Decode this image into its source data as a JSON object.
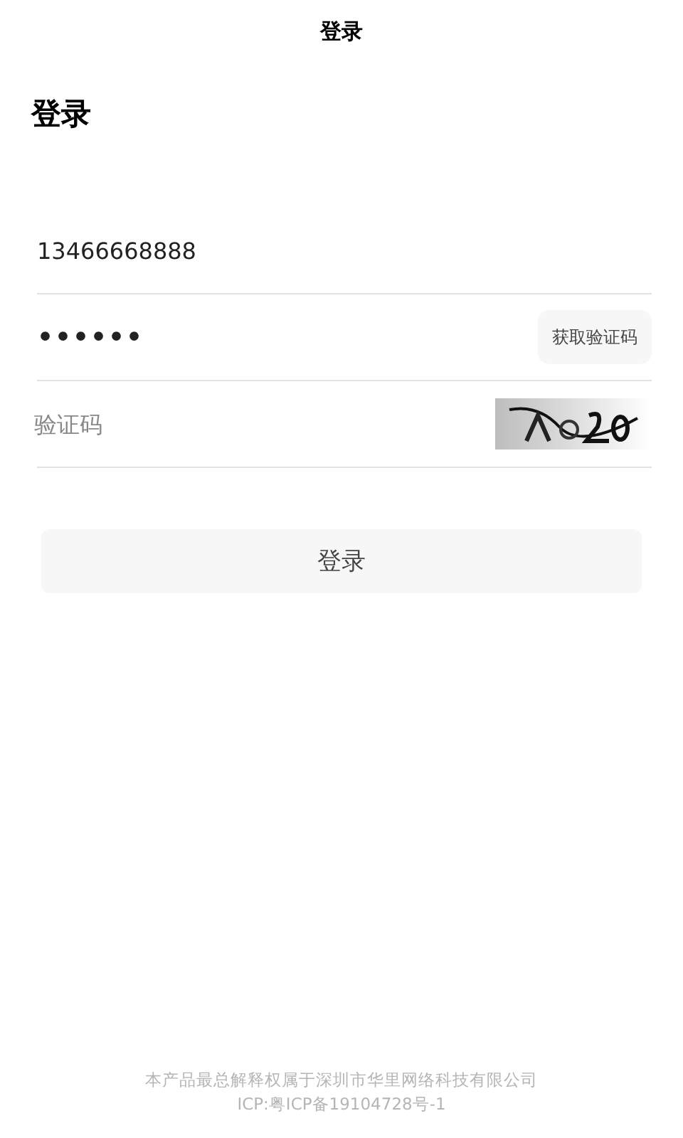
{
  "nav_title": "登录",
  "heading": "登录",
  "fields": [
    {
      "kind": "phone",
      "value": "13466668888"
    },
    {
      "kind": "password",
      "value": "••••••",
      "button": "获取验证码"
    },
    {
      "kind": "captcha",
      "placeholder": "验证码"
    }
  ],
  "login_button": "登录",
  "footer": [
    "本产品最总解释权属于深圳市华里网络科技有限公司",
    "ICP:粤ICP备19104728号-1"
  ]
}
